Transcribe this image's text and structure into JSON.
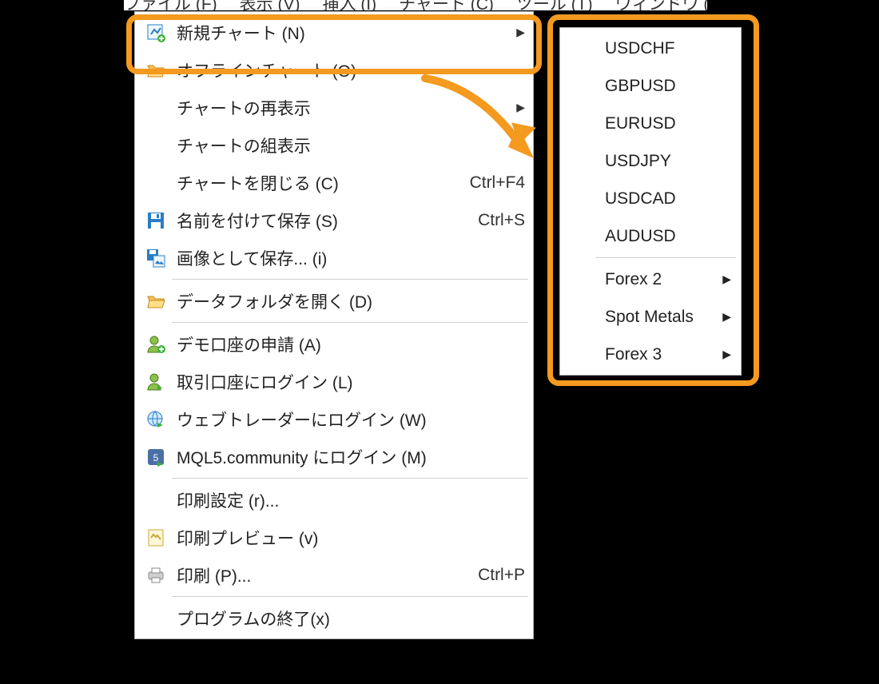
{
  "menubar": {
    "items": [
      "ファイル (F)",
      "表示 (V)",
      "挿入 (I)",
      "チャート (C)",
      "ツール (T)",
      "ウィンドウ (W)"
    ]
  },
  "file_menu": {
    "items": [
      {
        "icon": "new-chart-icon",
        "label": "新規チャート (N)",
        "shortcut": "",
        "has_submenu": true
      },
      {
        "icon": "folder-open-icon",
        "label": "オフラインチャート (O)",
        "shortcut": "",
        "has_submenu": false
      },
      {
        "icon": "",
        "label": "チャートの再表示",
        "shortcut": "",
        "has_submenu": true
      },
      {
        "icon": "",
        "label": "チャートの組表示",
        "shortcut": "",
        "has_submenu": true
      },
      {
        "icon": "",
        "label": "チャートを閉じる (C)",
        "shortcut": "Ctrl+F4",
        "has_submenu": false
      },
      {
        "icon": "save-icon",
        "label": "名前を付けて保存 (S)",
        "shortcut": "Ctrl+S",
        "has_submenu": false
      },
      {
        "icon": "save-image-icon",
        "label": "画像として保存... (i)",
        "shortcut": "",
        "has_submenu": false
      },
      {
        "sep": true
      },
      {
        "icon": "folder-open-icon",
        "label": "データフォルダを開く (D)",
        "shortcut": "",
        "has_submenu": false
      },
      {
        "sep": true
      },
      {
        "icon": "user-add-icon",
        "label": "デモ口座の申請 (A)",
        "shortcut": "",
        "has_submenu": false
      },
      {
        "icon": "user-login-icon",
        "label": "取引口座にログイン (L)",
        "shortcut": "",
        "has_submenu": false
      },
      {
        "icon": "globe-icon",
        "label": "ウェブトレーダーにログイン (W)",
        "shortcut": "",
        "has_submenu": false
      },
      {
        "icon": "mql5-icon",
        "label": "MQL5.community にログイン (M)",
        "shortcut": "",
        "has_submenu": false
      },
      {
        "sep": true
      },
      {
        "icon": "",
        "label": "印刷設定 (r)...",
        "shortcut": "",
        "has_submenu": false
      },
      {
        "icon": "print-preview-icon",
        "label": "印刷プレビュー (v)",
        "shortcut": "",
        "has_submenu": false
      },
      {
        "icon": "printer-icon",
        "label": "印刷 (P)...",
        "shortcut": "Ctrl+P",
        "has_submenu": false
      },
      {
        "sep": true
      },
      {
        "icon": "",
        "label": "プログラムの終了(x)",
        "shortcut": "",
        "has_submenu": false
      }
    ]
  },
  "new_chart_submenu": {
    "items": [
      {
        "label": "USDCHF",
        "has_submenu": false
      },
      {
        "label": "GBPUSD",
        "has_submenu": false
      },
      {
        "label": "EURUSD",
        "has_submenu": false
      },
      {
        "label": "USDJPY",
        "has_submenu": false
      },
      {
        "label": "USDCAD",
        "has_submenu": false
      },
      {
        "label": "AUDUSD",
        "has_submenu": false
      },
      {
        "sep": true
      },
      {
        "label": "Forex 2",
        "has_submenu": true
      },
      {
        "label": "Spot Metals",
        "has_submenu": true
      },
      {
        "label": "Forex 3",
        "has_submenu": true
      }
    ]
  },
  "highlight_color": "#f39a1f"
}
